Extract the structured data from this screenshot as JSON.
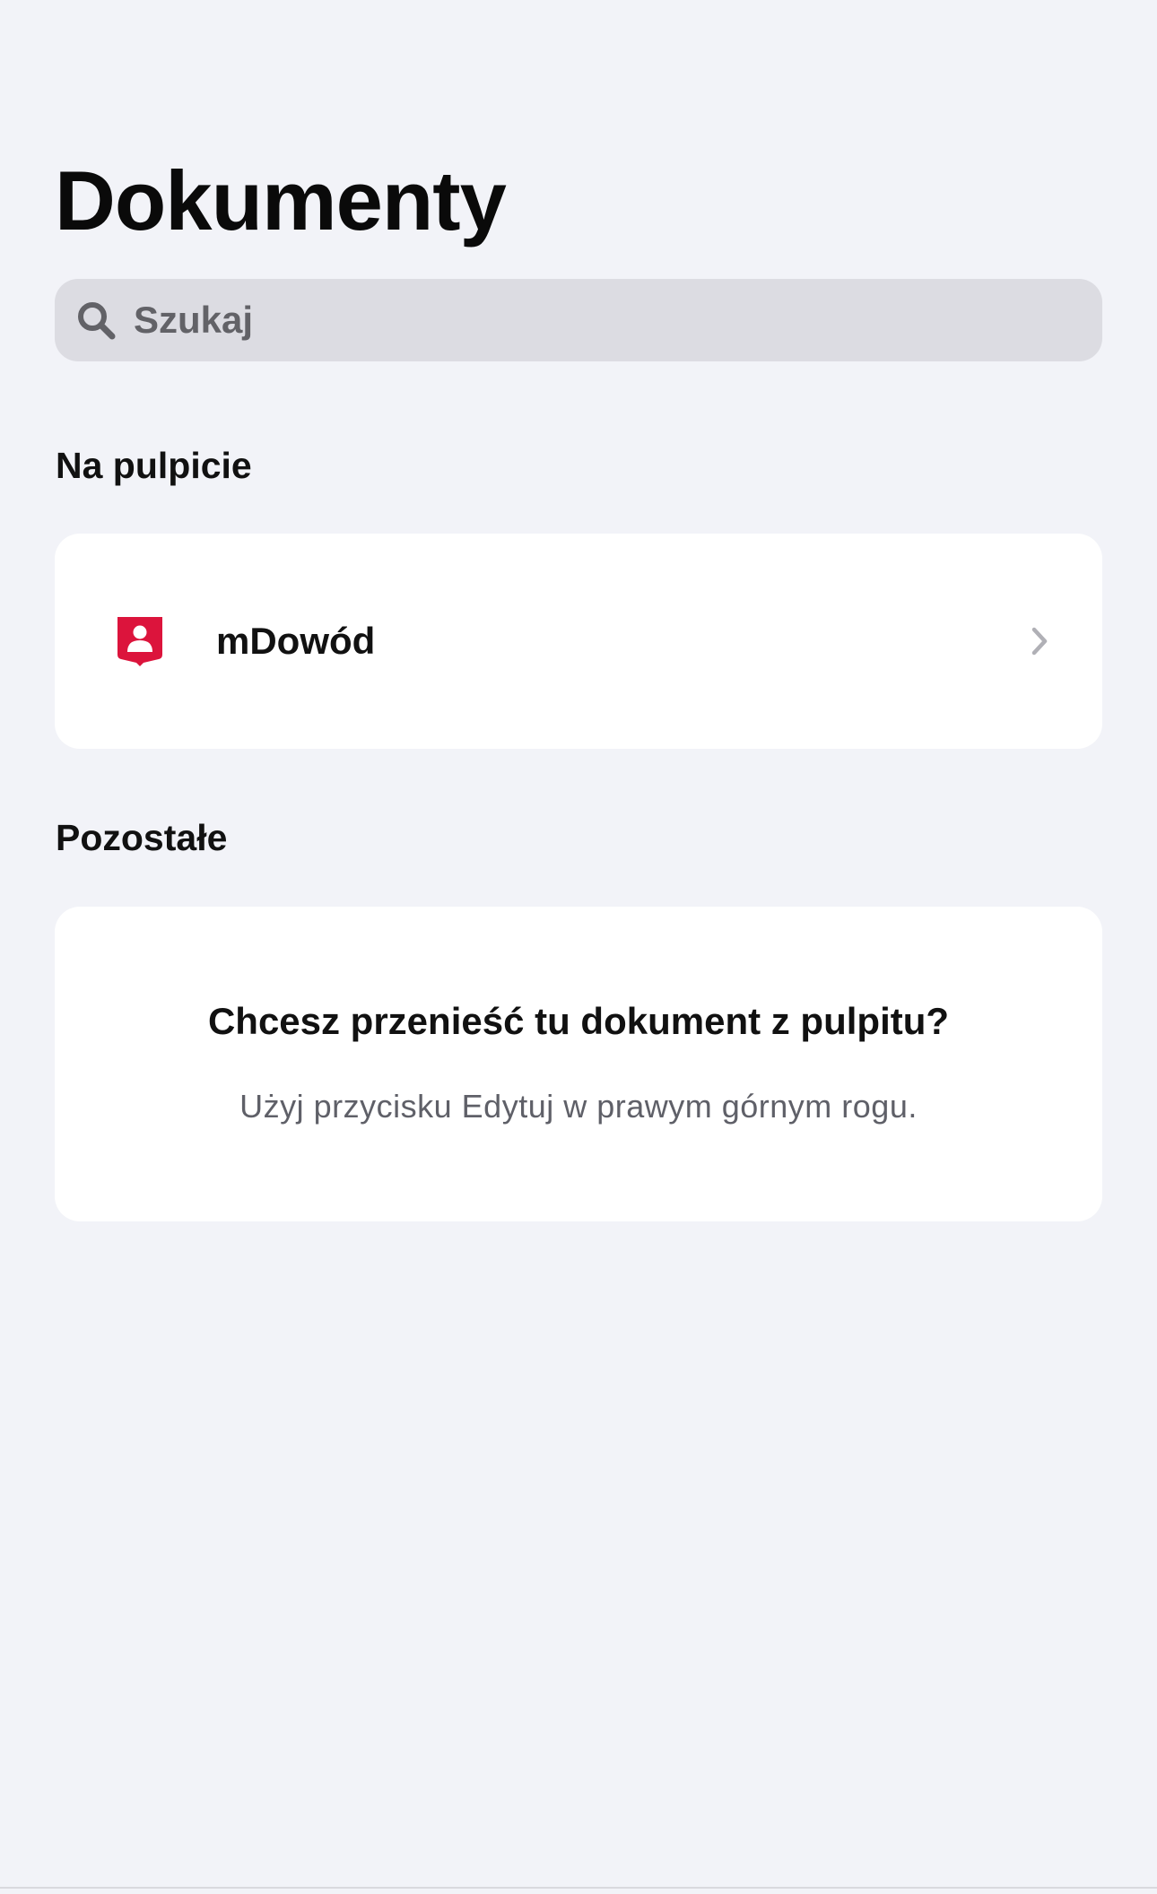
{
  "header": {
    "title": "Dokumenty"
  },
  "search": {
    "placeholder": "Szukaj",
    "icon": "search-icon"
  },
  "sections": {
    "desktop": {
      "heading": "Na pulpicie",
      "items": [
        {
          "label": "mDowód",
          "icon": "id-card-shield-icon",
          "icon_color": "#dc143c",
          "trailing_icon": "chevron-right-icon"
        }
      ]
    },
    "other": {
      "heading": "Pozostałe",
      "empty_state": {
        "title": "Chcesz przenieść tu dokument z pulpitu?",
        "subtitle": "Użyj przycisku Edytuj w prawym górnym rogu."
      }
    }
  },
  "colors": {
    "background": "#f2f3f8",
    "card": "#ffffff",
    "search_background": "#dcdce2",
    "accent_red": "#dc143c",
    "secondary_text": "#5f6068"
  }
}
